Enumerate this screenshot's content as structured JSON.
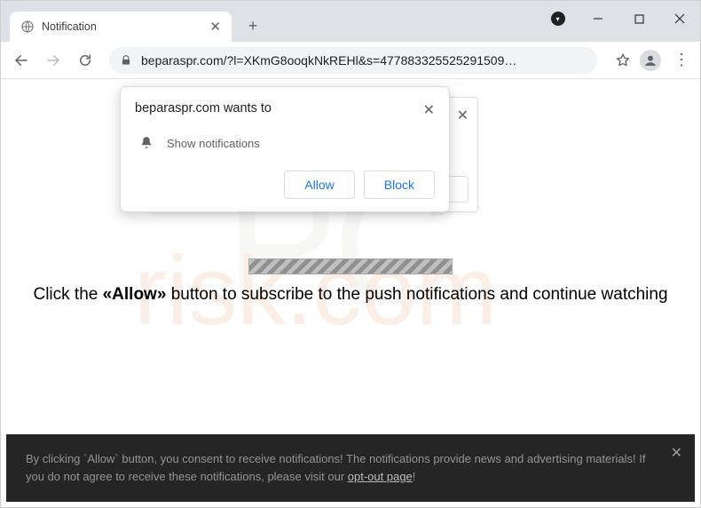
{
  "tab": {
    "title": "Notification"
  },
  "url": "beparaspr.com/?l=XKmG8ooqkNkREHl&s=477883325525291509…",
  "permission": {
    "origin_text": "beparaspr.com wants to",
    "message": "Show notifications",
    "allow": "Allow",
    "block": "Block"
  },
  "instruction": {
    "pre": "Click the ",
    "bold": "«Allow»",
    "post": " button to subscribe to the push notifications and continue watching"
  },
  "footer": {
    "text_a": "By clicking `Allow` button, you consent to receive notifications! The notifications provide news and advertising materials! If you do not agree to receive these notifications, please visit our ",
    "link": "opt-out page",
    "text_b": "!"
  }
}
